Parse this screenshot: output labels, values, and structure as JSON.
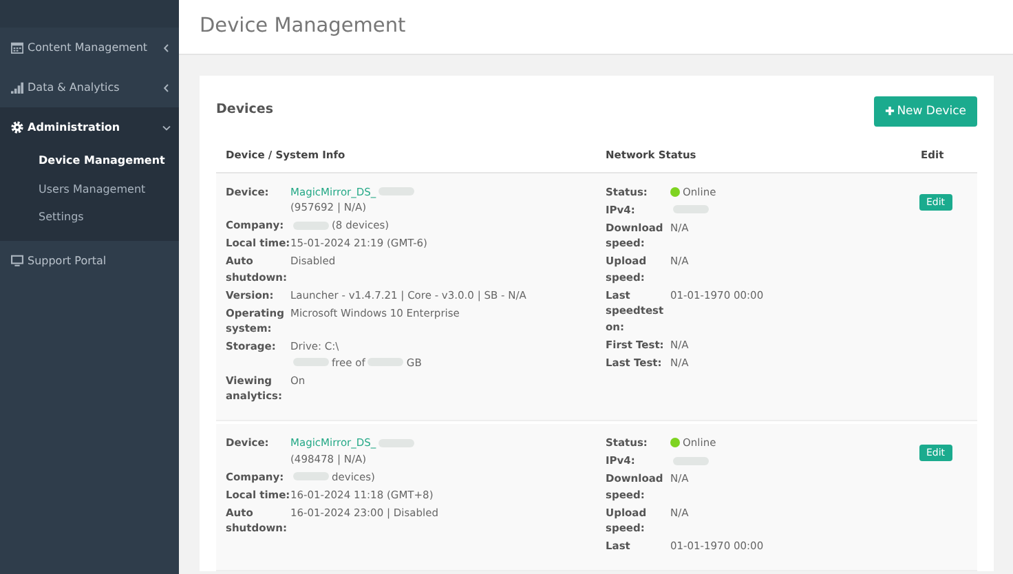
{
  "sidebar": {
    "items": [
      {
        "label": "Content Management",
        "expanded": false
      },
      {
        "label": "Data & Analytics",
        "expanded": false
      },
      {
        "label": "Administration",
        "expanded": true,
        "children": [
          {
            "label": "Device Management",
            "selected": true
          },
          {
            "label": "Users Management",
            "selected": false
          },
          {
            "label": "Settings",
            "selected": false
          }
        ]
      },
      {
        "label": "Support Portal"
      }
    ]
  },
  "page": {
    "title": "Device Management"
  },
  "card": {
    "title": "Devices",
    "new_button": "New Device",
    "columns": [
      "Device / System Info",
      "Network Status",
      "Edit"
    ],
    "rows": [
      {
        "system": [
          {
            "label": "Device:",
            "lines": [
              [
                {
                  "kind": "link",
                  "text": "MagicMirror_DS_"
                },
                {
                  "kind": "redacted"
                }
              ],
              [
                {
                  "kind": "text",
                  "text": "(957692 | N/A)"
                }
              ]
            ]
          },
          {
            "label": "Company:",
            "lines": [
              [
                {
                  "kind": "redacted"
                },
                {
                  "kind": "text",
                  "text": "(8 devices)"
                }
              ]
            ]
          },
          {
            "label": "Local time:",
            "lines": [
              [
                {
                  "kind": "text",
                  "text": "15-01-2024 21:19 (GMT-6)"
                }
              ]
            ]
          },
          {
            "label": "Auto shutdown:",
            "lines": [
              [
                {
                  "kind": "text",
                  "text": "Disabled"
                }
              ]
            ]
          },
          {
            "label": "Version:",
            "lines": [
              [
                {
                  "kind": "text",
                  "text": "Launcher - v1.4.7.21 | Core - v3.0.0 | SB - N/A"
                }
              ]
            ]
          },
          {
            "label": "Operating system:",
            "lines": [
              [
                {
                  "kind": "text",
                  "text": "Microsoft Windows 10 Enterprise"
                }
              ]
            ]
          },
          {
            "label": "Storage:",
            "lines": [
              [
                {
                  "kind": "text",
                  "text": "Drive: C:\\"
                }
              ],
              [
                {
                  "kind": "redacted"
                },
                {
                  "kind": "text",
                  "text": "free of"
                },
                {
                  "kind": "redacted"
                },
                {
                  "kind": "text",
                  "text": "GB"
                }
              ]
            ]
          },
          {
            "label": "Viewing analytics:",
            "lines": [
              [
                {
                  "kind": "text",
                  "text": "On"
                }
              ]
            ]
          }
        ],
        "network": [
          {
            "label": "Status:",
            "lines": [
              [
                {
                  "kind": "status",
                  "text": "Online",
                  "color": "#7ed321"
                }
              ]
            ]
          },
          {
            "label": "IPv4:",
            "lines": [
              [
                {
                  "kind": "redacted"
                }
              ]
            ]
          },
          {
            "label": "Download speed:",
            "lines": [
              [
                {
                  "kind": "text",
                  "text": "N/A"
                }
              ]
            ]
          },
          {
            "label": "Upload speed:",
            "lines": [
              [
                {
                  "kind": "text",
                  "text": "N/A"
                }
              ]
            ]
          },
          {
            "label": "Last speedtest on:",
            "lines": [
              [
                {
                  "kind": "text",
                  "text": "01-01-1970 00:00"
                }
              ]
            ]
          },
          {
            "label": "First Test:",
            "lines": [
              [
                {
                  "kind": "text",
                  "text": "N/A"
                }
              ]
            ]
          },
          {
            "label": "Last Test:",
            "lines": [
              [
                {
                  "kind": "text",
                  "text": "N/A"
                }
              ]
            ]
          }
        ],
        "edit": "Edit"
      },
      {
        "system": [
          {
            "label": "Device:",
            "lines": [
              [
                {
                  "kind": "link",
                  "text": "MagicMirror_DS_"
                },
                {
                  "kind": "redacted"
                }
              ],
              [
                {
                  "kind": "text",
                  "text": "(498478 | N/A)"
                }
              ]
            ]
          },
          {
            "label": "Company:",
            "lines": [
              [
                {
                  "kind": "redacted"
                },
                {
                  "kind": "text",
                  "text": "devices)"
                }
              ]
            ]
          },
          {
            "label": "Local time:",
            "lines": [
              [
                {
                  "kind": "text",
                  "text": "16-01-2024 11:18 (GMT+8)"
                }
              ]
            ]
          },
          {
            "label": "Auto shutdown:",
            "lines": [
              [
                {
                  "kind": "text",
                  "text": "16-01-2024 23:00 | Disabled"
                }
              ]
            ]
          }
        ],
        "network": [
          {
            "label": "Status:",
            "lines": [
              [
                {
                  "kind": "status",
                  "text": "Online",
                  "color": "#7ed321"
                }
              ]
            ]
          },
          {
            "label": "IPv4:",
            "lines": [
              [
                {
                  "kind": "redacted"
                }
              ]
            ]
          },
          {
            "label": "Download speed:",
            "lines": [
              [
                {
                  "kind": "text",
                  "text": "N/A"
                }
              ]
            ]
          },
          {
            "label": "Upload speed:",
            "lines": [
              [
                {
                  "kind": "text",
                  "text": "N/A"
                }
              ]
            ]
          },
          {
            "label": "Last",
            "lines": [
              [
                {
                  "kind": "text",
                  "text": "01-01-1970 00:00"
                }
              ]
            ]
          }
        ],
        "edit": "Edit"
      }
    ]
  }
}
